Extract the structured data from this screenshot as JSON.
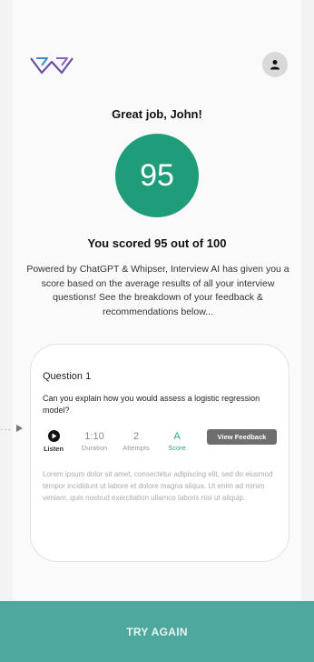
{
  "header": {
    "logo_icon": "w-logo-icon",
    "avatar_icon": "user-icon"
  },
  "greeting": "Great job, John!",
  "score": {
    "value": "95",
    "summary": "You scored 95 out of 100",
    "color": "#1f9d7b"
  },
  "description": "Powered by ChatGPT & Whipser, Interview AI has given you a score based on the average results of all your interview questions! See the breakdown of your feedback & recommendations below...",
  "question_card": {
    "title": "Question 1",
    "question": "Can you explain how you would assess a logistic regression model?",
    "listen_label": "Listen",
    "duration_value": "1:10",
    "duration_label": "Duration",
    "attempts_value": "2",
    "attempts_label": "Attempts",
    "score_value": "A",
    "score_label": "Score",
    "feedback_button": "View Feedback",
    "body": "Lorem ipsum dolor sit amet, consectetur adipiscing elit, sed do eiusmod tempor incididunt ut labore et dolore magna aliqua. Ut enim ad minim veniam, quis nostrud exercitation ullamco laboris nisi ut aliquip."
  },
  "footer": {
    "try_again_label": "TRY AGAIN",
    "color": "#4fa89d"
  }
}
